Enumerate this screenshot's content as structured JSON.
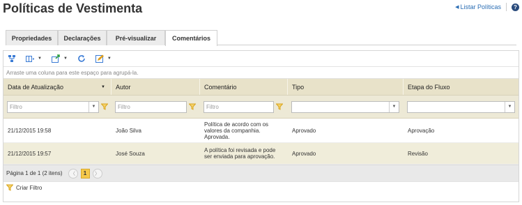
{
  "page": {
    "title": "Políticas de Vestimenta",
    "list_link": "Listar Políticas",
    "help_glyph": "?"
  },
  "tabs": [
    {
      "label": "Propriedades"
    },
    {
      "label": "Declarações"
    },
    {
      "label": "Pré-visualizar"
    },
    {
      "label": "Comentários",
      "active": true
    }
  ],
  "grid": {
    "group_hint": "Arraste uma coluna para este espaço para agrupá-la.",
    "columns": [
      "Data de Atualização",
      "Autor",
      "Comentário",
      "Tipo",
      "Etapa do Fluxo"
    ],
    "filter_placeholder": "Filtro",
    "rows": [
      {
        "date": "21/12/2015 19:58",
        "author": "João Silva",
        "comment": "Política de acordo com os\nvalores da companhia.\nAprovada.",
        "type": "Aprovado",
        "stage": "Aprovação"
      },
      {
        "date": "21/12/2015 19:57",
        "author": "José Souza",
        "comment": "A política foi revisada e pode\nser enviada para aprovação.",
        "type": "Aprovado",
        "stage": "Revisão"
      }
    ],
    "pager_text": "Página 1 de 1 (2 itens)",
    "current_page": "1",
    "create_filter": "Criar Filtro"
  },
  "colors": {
    "header_bg": "#e8e2c9",
    "alt_row_bg": "#f0edda",
    "link": "#2a6db4",
    "page_active": "#f5c84a",
    "filter_icon": "#d9a520"
  }
}
